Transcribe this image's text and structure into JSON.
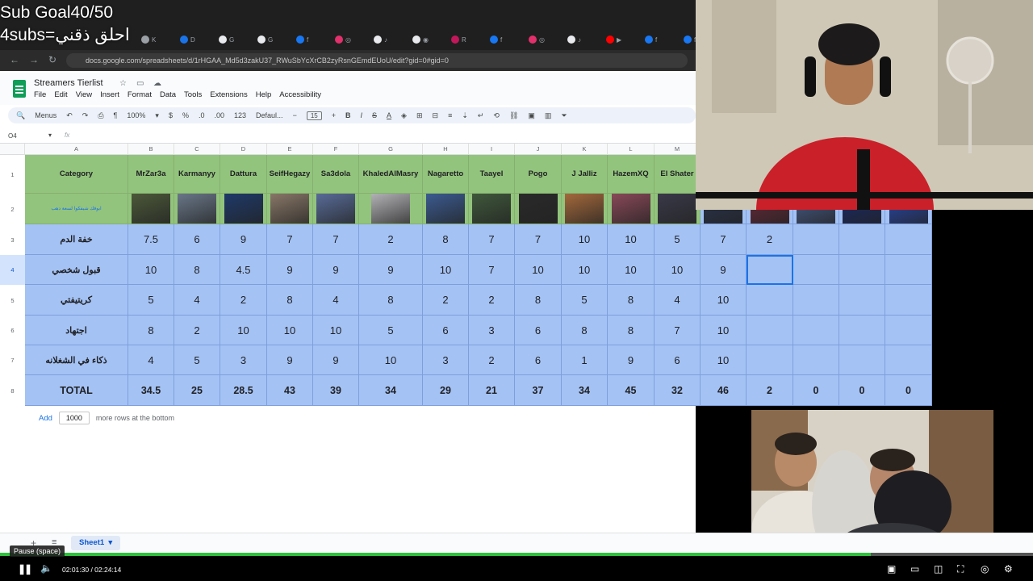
{
  "overlay": {
    "sub_goal": "Sub Goal40/50",
    "sub_info": "4subs=احلق ذقني"
  },
  "browser": {
    "url": "docs.google.com/spreadsheets/d/1rHGAA_Md5d3zakU37_RWuSbYcXrCB2zyRsnGEmdEUoU/edit?gid=0#gid=0",
    "tabs": [
      "K",
      "D",
      "G",
      "G",
      "f",
      "◎",
      "♪",
      "◉",
      "R",
      "f",
      "◎",
      "♪",
      "▶",
      "f",
      "f",
      "◎",
      "♪",
      "♪",
      "G"
    ]
  },
  "sheets": {
    "title": "Streamers Tierlist",
    "menu": [
      "File",
      "Edit",
      "View",
      "Insert",
      "Format",
      "Data",
      "Tools",
      "Extensions",
      "Help",
      "Accessibility"
    ],
    "toolbar": {
      "menus": "Menus",
      "zoom": "100%",
      "currency": "$",
      "percent": "%",
      "dec_less": ".0",
      "dec_more": ".00",
      "num_format": "123",
      "font": "Defaul...",
      "font_minus": "−",
      "font_size": "15",
      "font_plus": "+",
      "bold": "B",
      "italic": "I",
      "strike": "S",
      "text_color": "A"
    },
    "name_box": "O4",
    "fx": "fx",
    "columns": [
      "A",
      "B",
      "C",
      "D",
      "E",
      "F",
      "G",
      "H",
      "I",
      "J",
      "K",
      "L",
      "M"
    ],
    "rows": [
      "1",
      "2",
      "3",
      "4",
      "5",
      "6",
      "7",
      "8"
    ],
    "header_row": [
      "Category",
      "MrZar3a",
      "Karmanyy",
      "Dattura",
      "SeifHegazy",
      "Sa3dola",
      "KhaledAlMasry",
      "Nagaretto",
      "Taayel",
      "Pogo",
      "J Jalliz",
      "HazemXQ",
      "El Shater",
      "",
      "",
      "",
      "",
      ""
    ],
    "image_row_text": "ابوقك شيفكوا لسعة دهب",
    "body": [
      [
        "خفة الدم",
        "7.5",
        "6",
        "9",
        "7",
        "7",
        "2",
        "8",
        "7",
        "7",
        "10",
        "10",
        "5",
        "7",
        "2",
        "",
        "",
        ""
      ],
      [
        "قبول شخصي",
        "10",
        "8",
        "4.5",
        "9",
        "9",
        "9",
        "10",
        "7",
        "10",
        "10",
        "10",
        "10",
        "9",
        "",
        "",
        "",
        ""
      ],
      [
        "كريتيفتي",
        "5",
        "4",
        "2",
        "8",
        "4",
        "8",
        "2",
        "2",
        "8",
        "5",
        "8",
        "4",
        "10",
        "",
        "",
        "",
        ""
      ],
      [
        "اجتهاد",
        "8",
        "2",
        "10",
        "10",
        "10",
        "5",
        "6",
        "3",
        "6",
        "8",
        "8",
        "7",
        "10",
        "",
        "",
        "",
        ""
      ],
      [
        "ذكاء في الشغلانه",
        "4",
        "5",
        "3",
        "9",
        "9",
        "10",
        "3",
        "2",
        "6",
        "1",
        "9",
        "6",
        "10",
        "",
        "",
        "",
        ""
      ],
      [
        "TOTAL",
        "34.5",
        "25",
        "28.5",
        "43",
        "39",
        "34",
        "29",
        "21",
        "37",
        "34",
        "45",
        "32",
        "46",
        "2",
        "0",
        "0",
        "0"
      ]
    ],
    "photo_colors": [
      "#4d5a3a",
      "#6c7a8c",
      "#1e3a6b",
      "#8c7a6a",
      "#5a6e9c",
      "#b8b8bc",
      "#3c5d94",
      "#405a3c",
      "#2a2a2a",
      "#a86b3c",
      "#8c4a5a",
      "#3a3a4a",
      "#2a3550",
      "#6a2a3a",
      "#4a5e8c",
      "#1a2a6a",
      "#2a4ab0"
    ],
    "add_rows": {
      "button": "Add",
      "count": "1000",
      "suffix": "more rows at the bottom"
    },
    "sheet_tab": "Sheet1"
  },
  "player": {
    "tooltip": "Pause (space)",
    "time": "02:01:30 / 02:24:14",
    "progress": 0.843
  }
}
